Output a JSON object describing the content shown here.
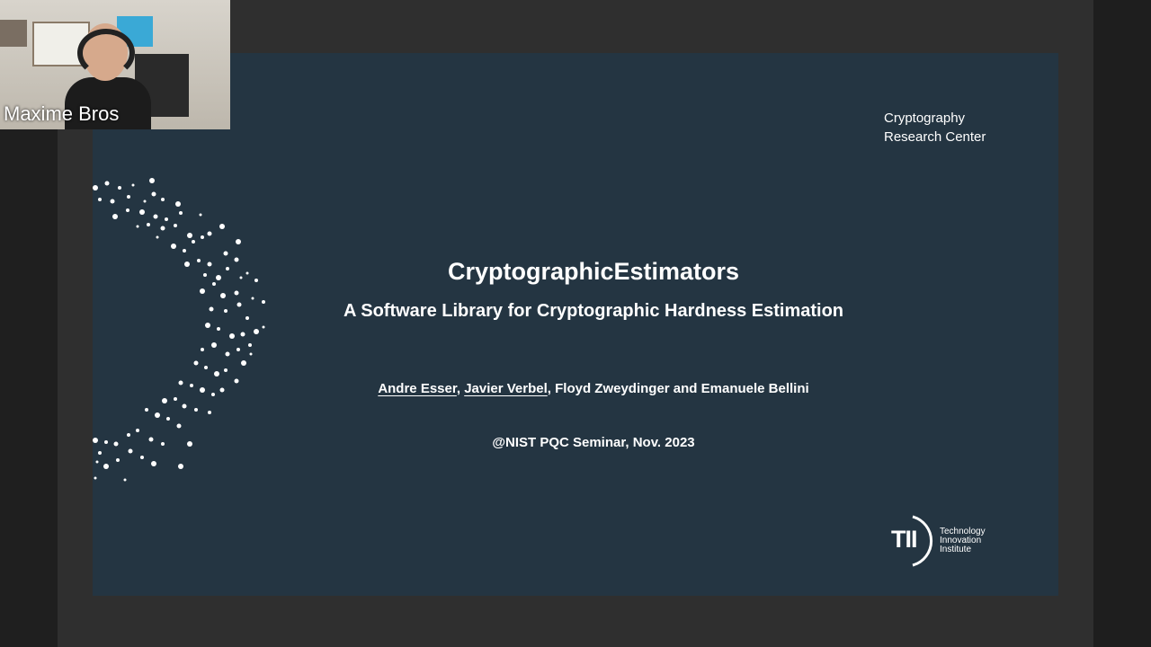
{
  "participant": {
    "name": "Maxime Bros"
  },
  "slide": {
    "org": "Cryptography\nResearch Center",
    "title": "CryptographicEstimators",
    "subtitle": "A Software Library for Cryptographic Hardness Estimation",
    "authors": {
      "author1": "Andre  Esser",
      "sep1": ", ",
      "author2": "Javier Verbel",
      "rest": ", Floyd Zweydinger and Emanuele Bellini"
    },
    "venue": "@NIST PQC Seminar, Nov. 2023",
    "logo": {
      "mark": "TII",
      "text": "Technology\nInnovation\nInstitute"
    }
  },
  "colors": {
    "slide_bg": "#243542",
    "frame_bg": "#2f2f2f",
    "text": "#ffffff"
  }
}
